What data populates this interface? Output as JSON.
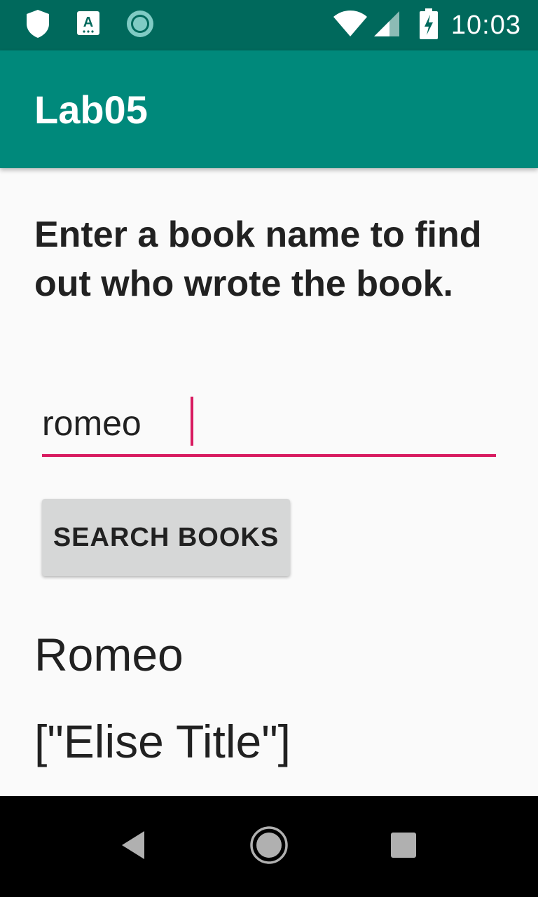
{
  "status_bar": {
    "time": "10:03",
    "icons": [
      "shield-icon",
      "accessibility-icon",
      "sync-icon",
      "wifi-icon",
      "signal-icon",
      "battery-charging-icon"
    ]
  },
  "app_bar": {
    "title": "Lab05"
  },
  "main": {
    "instructions": "Enter a book name to find out who wrote the book.",
    "book_input": {
      "value": "romeo",
      "placeholder": ""
    },
    "search_button_label": "SEARCH BOOKS",
    "result": {
      "title": "Romeo",
      "authors": "[\"Elise Title\"]"
    }
  },
  "nav_bar": {
    "buttons": [
      "back-icon",
      "home-icon",
      "recents-icon"
    ]
  },
  "colors": {
    "status_bar": "#00695c",
    "app_bar": "#00897b",
    "accent": "#d81b60",
    "button_bg": "#d6d7d7",
    "background": "#fafafa"
  }
}
